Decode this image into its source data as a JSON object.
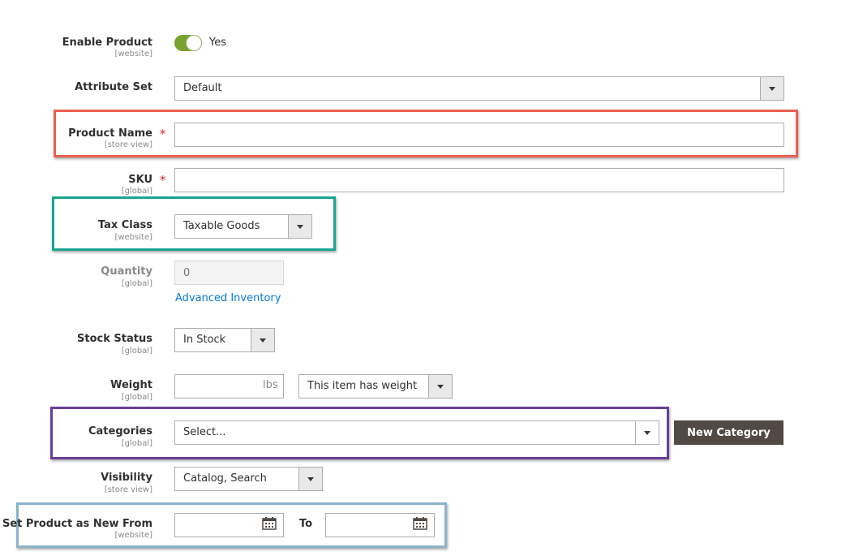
{
  "colors": {
    "red_highlight": "#e8614f",
    "teal_highlight": "#1aa58e",
    "purple_highlight": "#6a3d99",
    "blue_highlight": "#8bb3c9",
    "toggle_on": "#79a22e",
    "link": "#007bdb",
    "button": "#514943"
  },
  "fields": {
    "enable_product": {
      "label": "Enable Product",
      "scope": "[website]",
      "value": "Yes"
    },
    "attribute_set": {
      "label": "Attribute Set",
      "value": "Default"
    },
    "product_name": {
      "label": "Product Name",
      "scope": "[store view]",
      "required": "*",
      "value": ""
    },
    "sku": {
      "label": "SKU",
      "scope": "[global]",
      "required": "*",
      "value": ""
    },
    "tax_class": {
      "label": "Tax Class",
      "scope": "[website]",
      "value": "Taxable Goods"
    },
    "quantity": {
      "label": "Quantity",
      "scope": "[global]",
      "placeholder": "0",
      "link": "Advanced Inventory"
    },
    "stock_status": {
      "label": "Stock Status",
      "scope": "[global]",
      "value": "In Stock"
    },
    "weight": {
      "label": "Weight",
      "scope": "[global]",
      "unit": "lbs",
      "value": "",
      "type_value": "This item has weight"
    },
    "categories": {
      "label": "Categories",
      "scope": "[global]",
      "value": "Select...",
      "button": "New Category"
    },
    "visibility": {
      "label": "Visibility",
      "scope": "[store view]",
      "value": "Catalog, Search"
    },
    "new_from": {
      "label": "Set Product as New From",
      "scope": "[website]",
      "to_label": "To"
    }
  },
  "icons": {
    "calendar": "calendar-icon",
    "dropdown": "chevron-down-icon"
  }
}
